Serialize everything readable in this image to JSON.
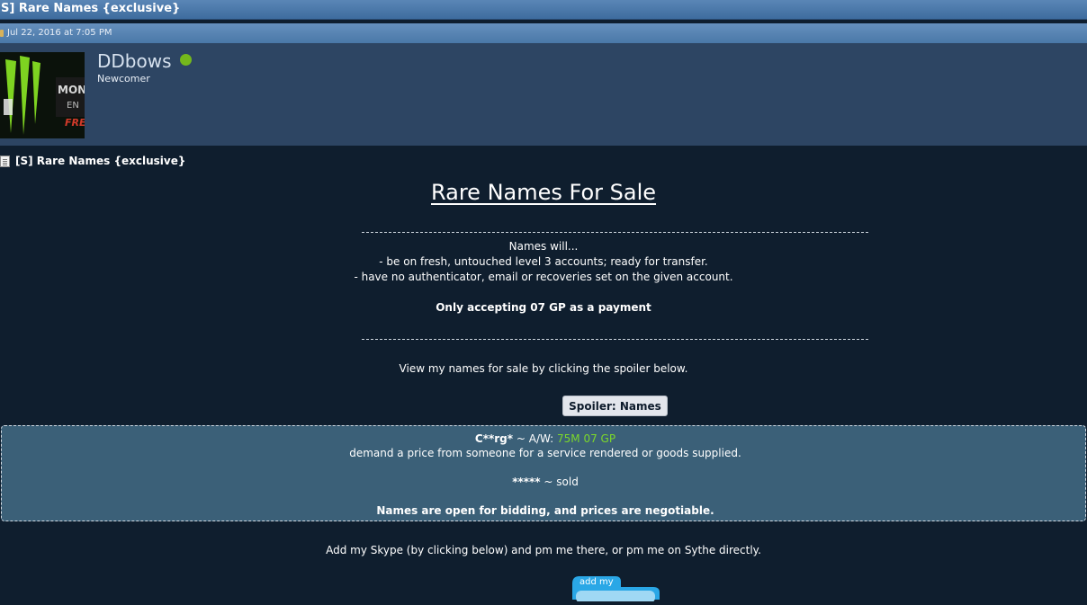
{
  "thread": {
    "title": "S] Rare Names {exclusive}",
    "date": "Jul 22, 2016 at 7:05 PM"
  },
  "user": {
    "name": "DDbows",
    "rank": "Newcomer",
    "avatar_text": "MON EN FRE",
    "status_color": "#74b81c"
  },
  "post": {
    "title": "[S] Rare Names {exclusive}",
    "heading": "Rare Names For Sale",
    "intro": "Names will...",
    "bullets": [
      "- be on fresh, untouched level 3 accounts; ready for transfer.",
      "- have no authenticator, email or recoveries set on the given account."
    ],
    "payment": "Only accepting 07 GP as a payment",
    "view_note": "View my names for sale by clicking the spoiler below.",
    "spoiler_label": "Spoiler: Names",
    "spoiler": {
      "name1": "C**rg*",
      "name1_sep": " ~ A/W: ",
      "name1_price": "75M 07 GP",
      "name1_desc": "demand a price from someone for a service rendered or goods supplied.",
      "name2": "*****",
      "name2_status": " ~ sold",
      "bidding": "Names are open for bidding, and prices are negotiable."
    },
    "contact": "Add my Skype (by clicking below) and pm me there, or pm me on Sythe directly.",
    "skype_badge": "add my"
  },
  "colors": {
    "page_bg": "#0f1e2e",
    "user_bar_bg": "#2d4563",
    "spoiler_bg": "#3b6078",
    "price_green": "#7cd82a"
  }
}
